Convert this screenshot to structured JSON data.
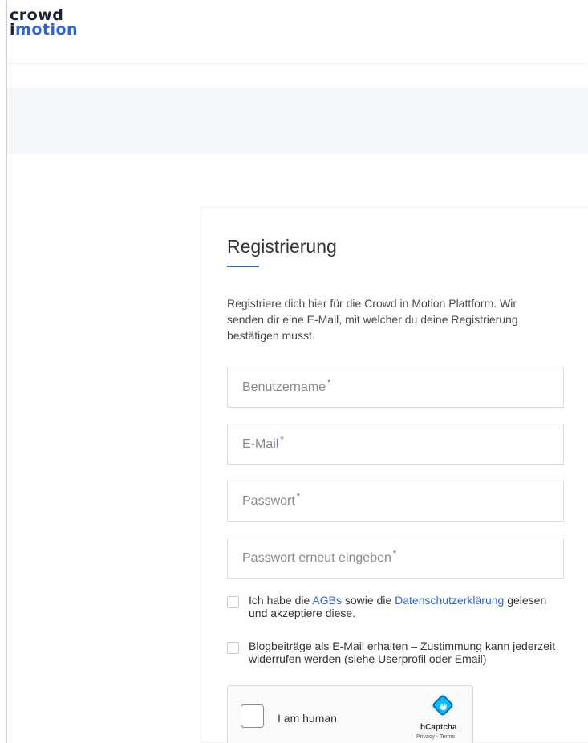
{
  "logo": {
    "line1": "crowd",
    "line2_i": "i",
    "line2_rest": "motion"
  },
  "form": {
    "title": "Registrierung",
    "intro": "Registriere dich hier für die Crowd in Motion Plattform. Wir senden dir eine E-Mail, mit welcher du deine Registrierung bestätigen musst.",
    "required_marker": "*",
    "fields": {
      "username": {
        "label": "Benutzername",
        "value": ""
      },
      "email": {
        "label": "E-Mail",
        "value": ""
      },
      "password": {
        "label": "Passwort",
        "value": ""
      },
      "password_repeat": {
        "label": "Passwort erneut eingeben",
        "value": ""
      }
    },
    "terms": {
      "text_before": "Ich habe die ",
      "agb_link": "AGBs",
      "text_middle": " sowie die ",
      "privacy_link": "Datenschutzerklärung",
      "text_after": " gelesen und akzeptiere diese."
    },
    "newsletter": {
      "text": "Blogbeiträge als E-Mail erhalten – Zustimmung kann jederzeit widerrufen werden (siehe Userprofil oder Email)"
    }
  },
  "captcha": {
    "label": "I am human",
    "brand": "hCaptcha",
    "links": "Privacy - Terms"
  },
  "colors": {
    "accent": "#2e63d6",
    "banner": "#f4f6fa"
  }
}
